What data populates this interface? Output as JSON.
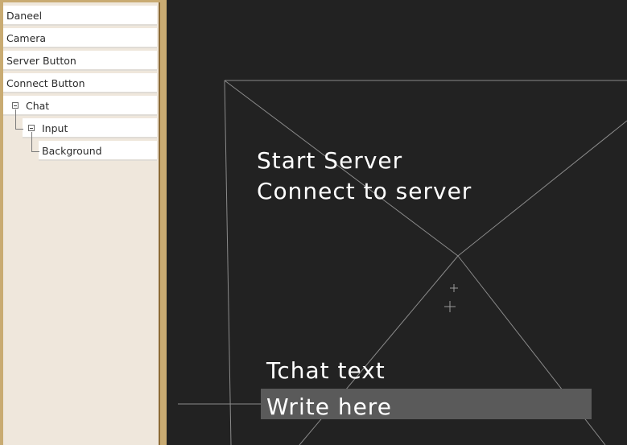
{
  "hierarchy": {
    "items": [
      {
        "label": "Daneel"
      },
      {
        "label": "Camera"
      },
      {
        "label": "Server Button"
      },
      {
        "label": "Connect Button"
      },
      {
        "label": "Chat"
      },
      {
        "label": "Input"
      },
      {
        "label": "Background"
      }
    ]
  },
  "viewport": {
    "start_server": "Start Server",
    "connect_server": "Connect to server",
    "chat_text": "Tchat text",
    "input_placeholder": "Write here"
  },
  "colors": {
    "viewport_bg": "#222222",
    "panel_frame": "#c9ab72",
    "panel_bg": "#efe7dc",
    "input_bg": "#5a5a5a"
  }
}
